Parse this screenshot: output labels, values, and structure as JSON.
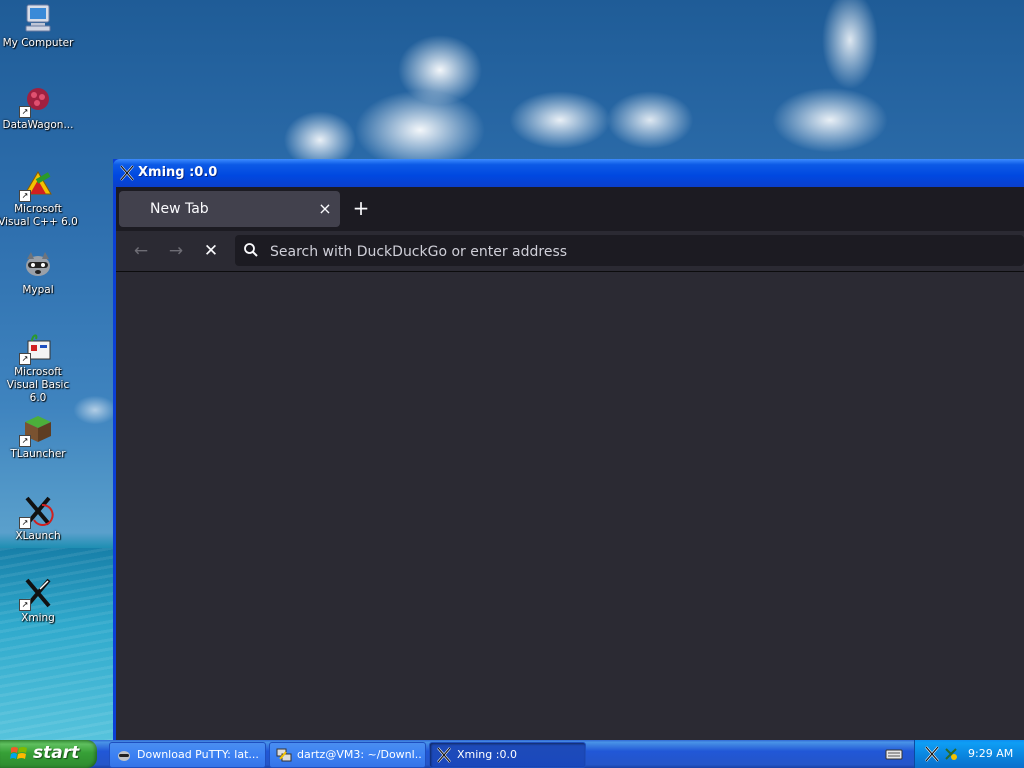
{
  "desktop": {
    "icons": [
      {
        "label": "My Computer",
        "icon": "my-computer-icon"
      },
      {
        "label": "DataWagon...",
        "icon": "datawagon-icon"
      },
      {
        "label": "Microsoft Visual C++ 6.0",
        "icon": "visual-cpp-icon"
      },
      {
        "label": "Mypal",
        "icon": "mypal-raccoon-icon"
      },
      {
        "label": "Microsoft Visual Basic 6.0",
        "icon": "visual-basic-icon"
      },
      {
        "label": "TLauncher",
        "icon": "tlauncher-grass-block-icon"
      },
      {
        "label": "XLaunch",
        "icon": "xlaunch-icon"
      },
      {
        "label": "Xming",
        "icon": "xming-icon"
      }
    ]
  },
  "window": {
    "title": "Xming :0.0",
    "browser": {
      "tabs": [
        {
          "label": "New Tab",
          "active": true
        }
      ],
      "new_tab_symbol": "+",
      "close_tab_symbol": "×",
      "nav": {
        "back": "←",
        "forward": "→",
        "stop": "✕"
      },
      "urlbar": {
        "placeholder": "Search with DuckDuckGo or enter address",
        "value": ""
      }
    }
  },
  "taskbar": {
    "start_label": "start",
    "tasks": [
      {
        "label": "Download PuTTY: lat...",
        "icon": "mypal-raccoon-icon",
        "active": false
      },
      {
        "label": "dartz@VM3: ~/Downl...",
        "icon": "putty-icon",
        "active": false
      },
      {
        "label": "Xming :0.0",
        "icon": "xming-icon",
        "active": true
      }
    ],
    "tray": {
      "clock": "9:29 AM",
      "icons": [
        "xming-tray-icon",
        "xlaunch-tray-icon"
      ]
    }
  },
  "colors": {
    "browser_bg": "#2b2a33",
    "tabstrip_bg": "#1c1b22",
    "tab_active": "#42414d",
    "xp_title_blue": "#0048e0",
    "xp_start_green": "#37a037"
  }
}
